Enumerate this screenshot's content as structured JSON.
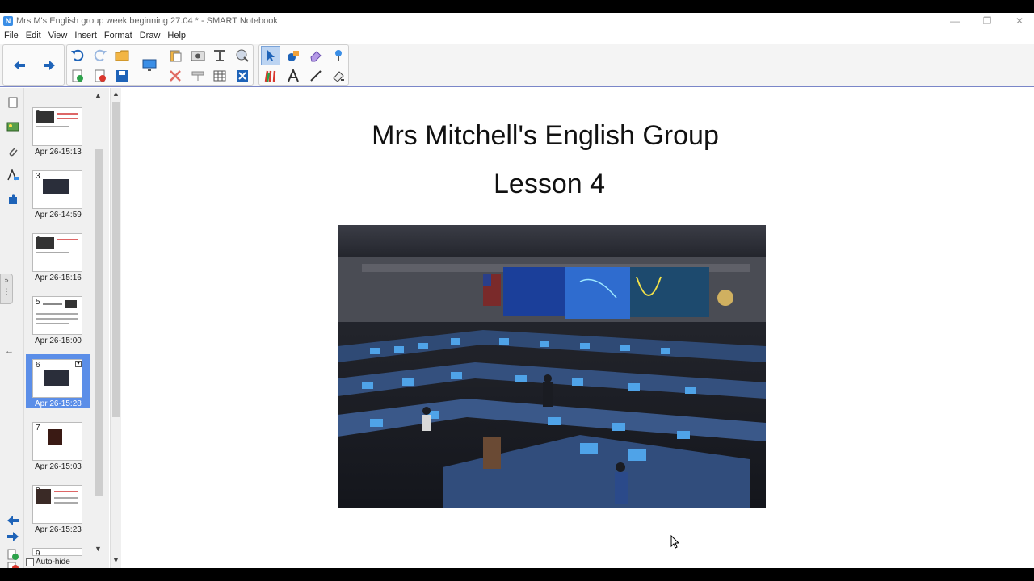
{
  "window": {
    "title": "Mrs M's English group week beginning 27.04 * - SMART Notebook"
  },
  "menu": [
    "File",
    "Edit",
    "View",
    "Insert",
    "Format",
    "Draw",
    "Help"
  ],
  "toolbar": {
    "accent": "#1e63b8",
    "buttons": [
      "back-icon",
      "forward-icon",
      "undo-icon",
      "redo-icon",
      "open-icon",
      "add-page-icon",
      "delete-page-icon",
      "save-icon",
      "display-icon",
      "paste-icon",
      "screen-capture-icon",
      "screen-shade-icon",
      "activity-icon",
      "delete-icon",
      "table-icon",
      "close-box-icon",
      "select-icon",
      "pen-icon",
      "eraser-icon",
      "magic-pen-icon",
      "creative-pen-icon",
      "text-icon",
      "line-icon",
      "fill-icon"
    ]
  },
  "sorter": {
    "pages": [
      {
        "num": "2",
        "date": "Apr 26-15:13"
      },
      {
        "num": "3",
        "date": "Apr 26-14:59"
      },
      {
        "num": "4",
        "date": "Apr 26-15:16"
      },
      {
        "num": "5",
        "date": "Apr 26-15:00"
      },
      {
        "num": "6",
        "date": "Apr 26-15:28",
        "selected": true
      },
      {
        "num": "7",
        "date": "Apr 26-15:03"
      },
      {
        "num": "8",
        "date": "Apr 26-15:23"
      },
      {
        "num": "9",
        "date": ""
      }
    ],
    "autohide_label": "Auto-hide",
    "selected_color": "#5b8ee8"
  },
  "canvas": {
    "title": "Mrs Mitchell's English Group",
    "subtitle": "Lesson 4"
  }
}
